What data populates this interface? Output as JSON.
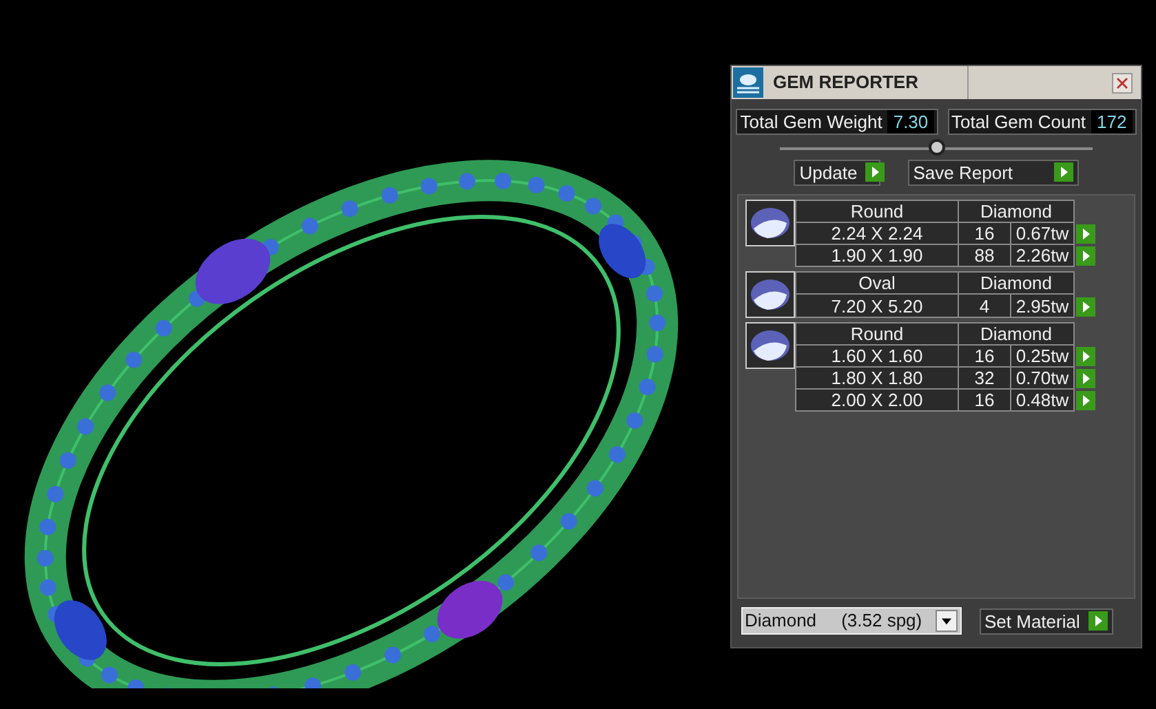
{
  "panel": {
    "title": "GEM REPORTER",
    "totals": [
      {
        "label": "Total Gem Weight",
        "value": "7.30"
      },
      {
        "label": "Total Gem Count",
        "value": "172"
      }
    ],
    "slider": {
      "level": 0.5
    },
    "buttons": [
      {
        "label": "Update"
      },
      {
        "label": "Save Report"
      }
    ],
    "groups": [
      {
        "shape": "Round",
        "material": "Diamond",
        "rows": [
          {
            "size": "2.24 X 2.24",
            "count": "16",
            "weight": "0.67tw"
          },
          {
            "size": "1.90 X 1.90",
            "count": "88",
            "weight": "2.26tw"
          }
        ]
      },
      {
        "shape": "Oval",
        "material": "Diamond",
        "rows": [
          {
            "size": "7.20 X 5.20",
            "count": "4",
            "weight": "2.95tw"
          }
        ]
      },
      {
        "shape": "Round",
        "material": "Diamond",
        "rows": [
          {
            "size": "1.60 X 1.60",
            "count": "16",
            "weight": "0.25tw"
          },
          {
            "size": "1.80 X 1.80",
            "count": "32",
            "weight": "0.70tw"
          },
          {
            "size": "2.00 X 2.00",
            "count": "16",
            "weight": "0.48tw"
          }
        ]
      }
    ],
    "material_select": {
      "value": "Diamond     (3.52 spg)"
    },
    "set_button": {
      "label": "Set Material"
    }
  }
}
